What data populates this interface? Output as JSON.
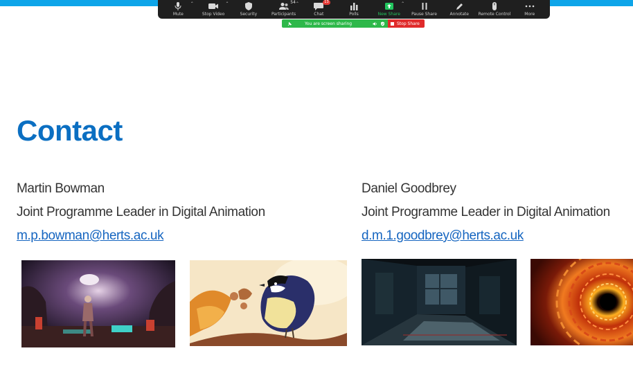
{
  "toolbar": {
    "items": [
      {
        "label": "Mute",
        "icon": "microphone-icon",
        "caret": "⌃"
      },
      {
        "label": "Stop Video",
        "icon": "video-camera-icon",
        "caret": "⌃"
      },
      {
        "label": "Security",
        "icon": "shield-icon"
      },
      {
        "label": "Participants",
        "icon": "participants-icon",
        "count": "54",
        "caret": "⌃"
      },
      {
        "label": "Chat",
        "icon": "chat-bubble-icon",
        "badge": "13"
      },
      {
        "label": "Polls",
        "icon": "bar-chart-icon"
      },
      {
        "label": "New Share",
        "icon": "share-screen-icon",
        "caret": "⌃"
      },
      {
        "label": "Pause Share",
        "icon": "pause-icon"
      },
      {
        "label": "Annotate",
        "icon": "pencil-icon"
      },
      {
        "label": "Remote Control",
        "icon": "mouse-icon"
      },
      {
        "label": "More",
        "icon": "ellipsis-icon"
      }
    ]
  },
  "share_bar": {
    "status": "You are screen sharing",
    "stop_label": "Stop Share"
  },
  "slide": {
    "title": "Contact",
    "contacts": [
      {
        "name": "Martin Bowman",
        "role": "Joint Programme Leader in Digital Animation",
        "email": "m.p.bowman@herts.ac.uk"
      },
      {
        "name": "Daniel Goodbrey",
        "role": "Joint Programme Leader in Digital Animation",
        "email": "d.m.1.goodbrey@herts.ac.uk"
      }
    ]
  },
  "colors": {
    "accent_blue": "#0b6fc2",
    "link_blue": "#1565c0",
    "share_green": "#2eb84a",
    "stop_red": "#e02b2b",
    "toolbar_bg": "#1f1f1f"
  }
}
